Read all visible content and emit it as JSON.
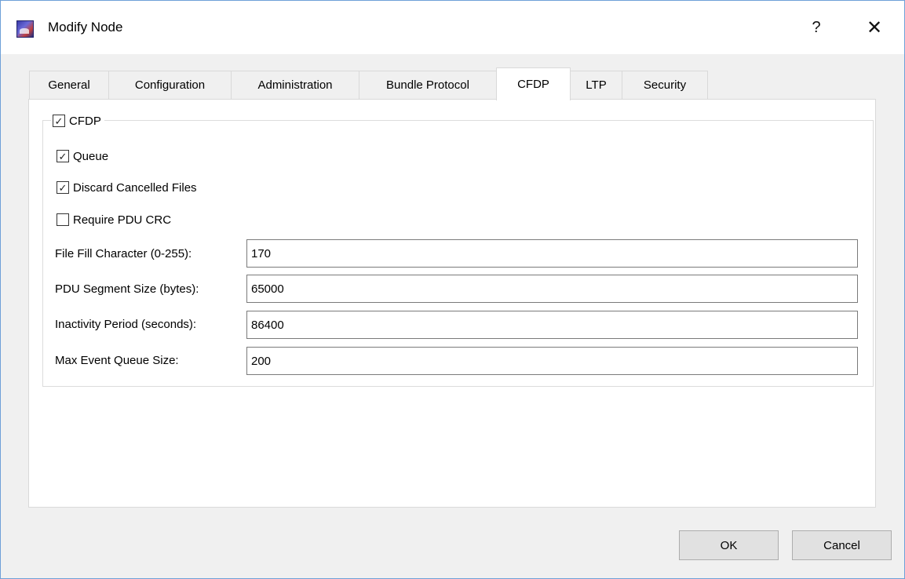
{
  "window": {
    "title": "Modify Node",
    "help_label": "?",
    "close_label": "✕"
  },
  "tabs": [
    {
      "label": "General"
    },
    {
      "label": "Configuration"
    },
    {
      "label": "Administration"
    },
    {
      "label": "Bundle Protocol"
    },
    {
      "label": "CFDP",
      "active": true
    },
    {
      "label": "LTP"
    },
    {
      "label": "Security"
    }
  ],
  "cfdp": {
    "group_label": "CFDP",
    "group_checked": true,
    "checkboxes": [
      {
        "label": "Queue",
        "checked": true
      },
      {
        "label": "Discard Cancelled Files",
        "checked": true
      },
      {
        "label": "Require PDU CRC",
        "checked": false
      }
    ],
    "fields": [
      {
        "label": "File Fill Character (0-255):",
        "value": "170"
      },
      {
        "label": "PDU Segment Size (bytes):",
        "value": "65000"
      },
      {
        "label": "Inactivity Period (seconds):",
        "value": "86400"
      },
      {
        "label": "Max Event Queue Size:",
        "value": "200"
      }
    ]
  },
  "buttons": {
    "ok": "OK",
    "cancel": "Cancel"
  }
}
